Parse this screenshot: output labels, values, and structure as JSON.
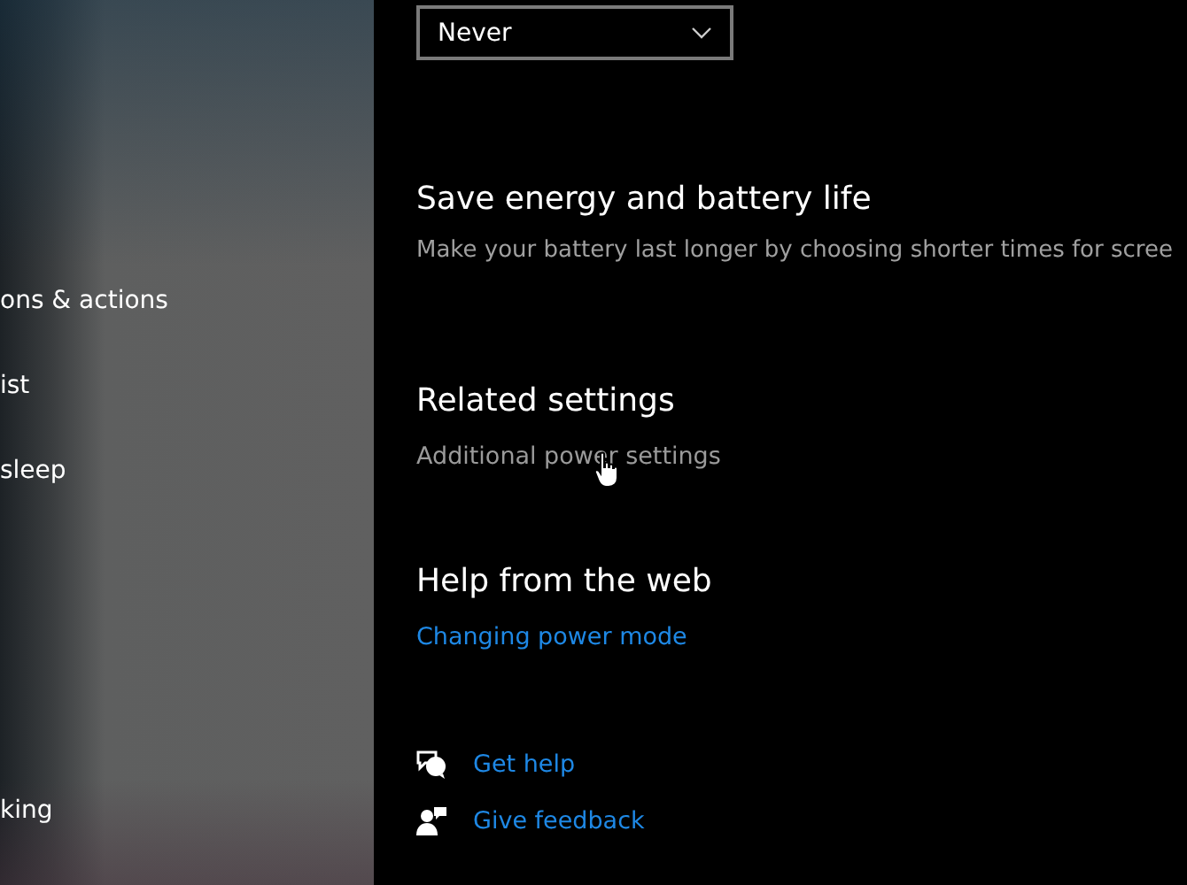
{
  "sidebar": {
    "items": [
      {
        "label": "ons & actions"
      },
      {
        "label": "ist"
      },
      {
        "label": "sleep"
      },
      {
        "label": "king"
      }
    ]
  },
  "dropdown": {
    "value": "Never"
  },
  "sections": [
    {
      "title": "Save energy and battery life",
      "text": "Make your battery last longer by choosing shorter times for scree"
    },
    {
      "title": "Related settings",
      "link": "Additional power settings",
      "muted": true
    },
    {
      "title": "Help from the web",
      "link": "Changing power mode",
      "muted": false
    }
  ],
  "help_links": [
    {
      "kind": "help",
      "label": "Get help"
    },
    {
      "kind": "feedback",
      "label": "Give feedback"
    }
  ]
}
